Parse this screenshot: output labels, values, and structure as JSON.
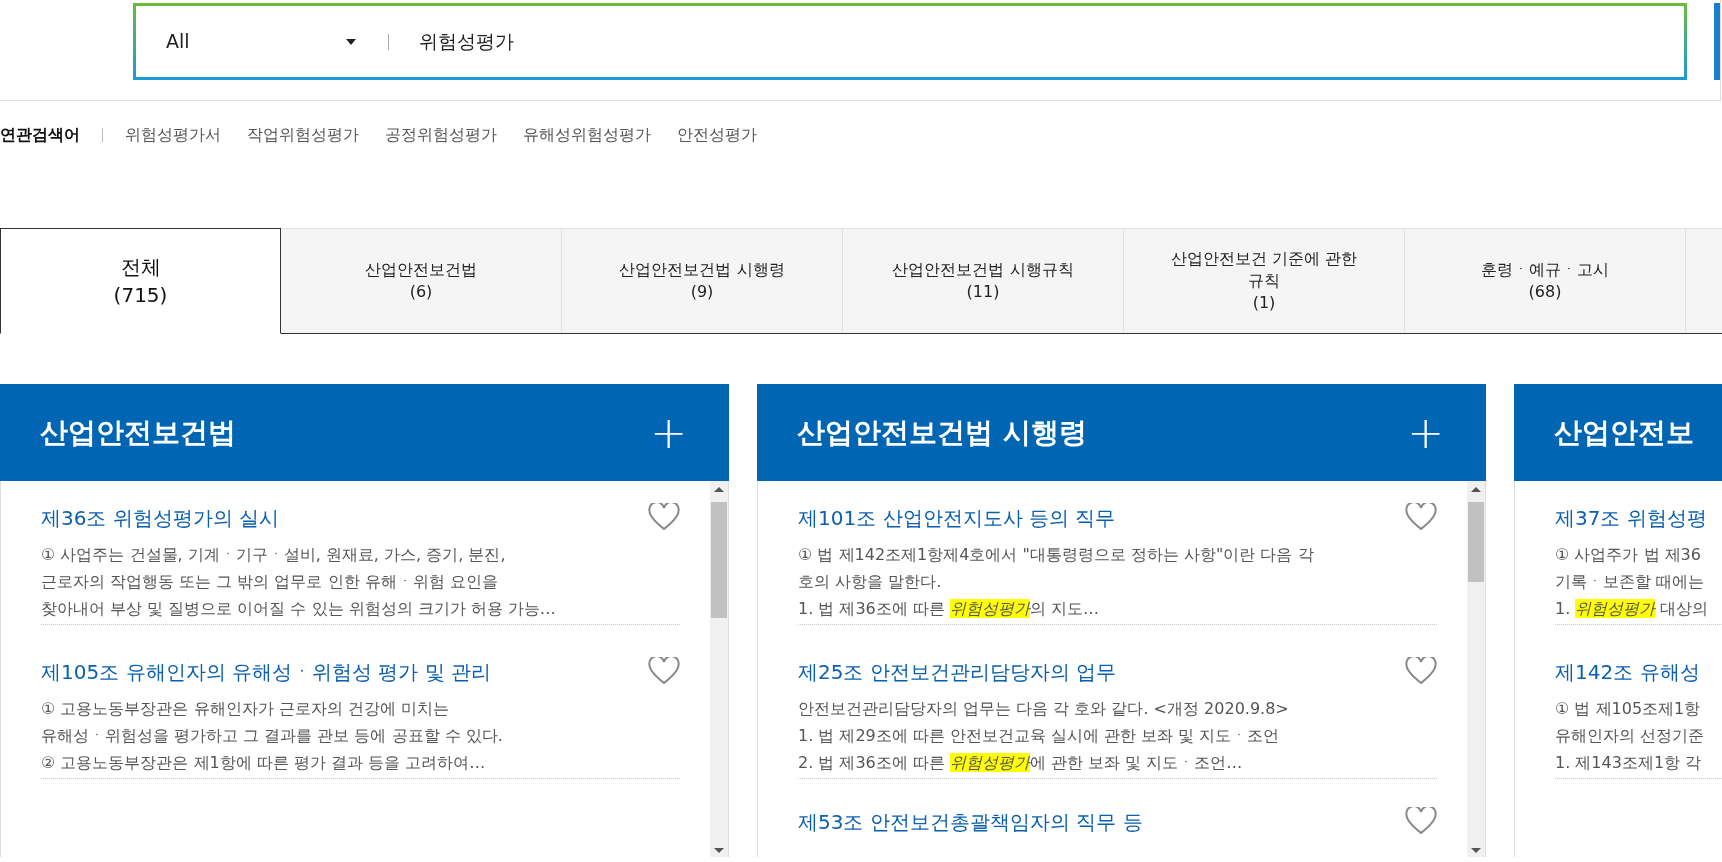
{
  "search": {
    "scope": "All",
    "query": "위험성평가"
  },
  "related": {
    "label": "연관검색어",
    "items": [
      "위험성평가서",
      "작업위험성평가",
      "공정위험성평가",
      "유해성위험성평가",
      "안전성평가"
    ]
  },
  "tabs": [
    {
      "label": "전체",
      "count": "(715)",
      "selected": true
    },
    {
      "label": "산업안전보건법",
      "count": "(6)",
      "selected": false
    },
    {
      "label": "산업안전보건법 시행령",
      "count": "(9)",
      "selected": false
    },
    {
      "label": "산업안전보건법 시행규칙",
      "count": "(11)",
      "selected": false
    },
    {
      "label": "산업안전보건 기준에 관한 규칙",
      "count": "(1)",
      "selected": false
    },
    {
      "label": "훈령ㆍ예규ㆍ고시",
      "count": "(68)",
      "selected": false
    }
  ],
  "cards": [
    {
      "title": "산업안전보건법",
      "expand": "+",
      "items": [
        {
          "title": "제36조 위험성평가의 실시",
          "lines": [
            [
              {
                "text": "① 사업주는 건설물, 기계ㆍ기구ㆍ설비, 원재료, 가스, 증기, 분진,",
                "highlight": false
              }
            ],
            [
              {
                "text": "근로자의 작업행동 또는 그 밖의 업무로 인한 유해ㆍ위험 요인을",
                "highlight": false
              }
            ],
            [
              {
                "text": "찾아내어 부상 및 질병으로 이어질 수 있는 위험성의 크기가 허용 가능…",
                "highlight": false
              }
            ]
          ]
        },
        {
          "title": "제105조 유해인자의 유해성ㆍ위험성 평가 및 관리",
          "lines": [
            [
              {
                "text": "① 고용노동부장관은 유해인자가 근로자의 건강에 미치는",
                "highlight": false
              }
            ],
            [
              {
                "text": "유해성ㆍ위험성을 평가하고 그 결과를 관보 등에 공표할 수 있다.",
                "highlight": false
              }
            ],
            [
              {
                "text": "② 고용노동부장관은 제1항에 따른 평가 결과 등을 고려하여…",
                "highlight": false
              }
            ]
          ]
        }
      ]
    },
    {
      "title": "산업안전보건법 시행령",
      "expand": "+",
      "items": [
        {
          "title": "제101조 산업안전지도사 등의 직무",
          "lines": [
            [
              {
                "text": "① 법 제142조제1항제4호에서 \"대통령령으로 정하는 사항\"이란 다음 각",
                "highlight": false
              }
            ],
            [
              {
                "text": "호의 사항을 말한다.",
                "highlight": false
              }
            ],
            [
              {
                "text": "1. 법 제36조에 따른 ",
                "highlight": false
              },
              {
                "text": "위험성평가",
                "highlight": true
              },
              {
                "text": "의 지도…",
                "highlight": false
              }
            ]
          ]
        },
        {
          "title": "제25조 안전보건관리담당자의 업무",
          "lines": [
            [
              {
                "text": "안전보건관리담당자의 업무는 다음 각 호와 같다. <개정 2020.9.8>",
                "highlight": false
              }
            ],
            [
              {
                "text": "1. 법 제29조에 따른 안전보건교육 실시에 관한 보좌 및 지도ㆍ조언",
                "highlight": false
              }
            ],
            [
              {
                "text": "2. 법 제36조에 따른 ",
                "highlight": false
              },
              {
                "text": "위험성평가",
                "highlight": true
              },
              {
                "text": "에 관한 보좌 및 지도ㆍ조언…",
                "highlight": false
              }
            ]
          ]
        },
        {
          "title": "제53조 안전보건총괄책임자의 직무 등"
        }
      ]
    },
    {
      "title": "산업안전보",
      "items": [
        {
          "title": "제37조 위험성평",
          "lines": [
            [
              {
                "text": "① 사업주가 법 제36",
                "highlight": false
              }
            ],
            [
              {
                "text": "기록ㆍ보존할 때에는",
                "highlight": false
              }
            ],
            [
              {
                "text": "1. ",
                "highlight": false
              },
              {
                "text": "위험성평가",
                "highlight": true
              },
              {
                "text": " 대상의",
                "highlight": false
              }
            ]
          ]
        },
        {
          "title": "제142조 유해성",
          "lines": [
            [
              {
                "text": "① 법 제105조제1항",
                "highlight": false
              }
            ],
            [
              {
                "text": "유해인자의 선정기준",
                "highlight": false
              }
            ],
            [
              {
                "text": "1. 제143조제1항 각",
                "highlight": false
              }
            ]
          ]
        }
      ]
    }
  ]
}
